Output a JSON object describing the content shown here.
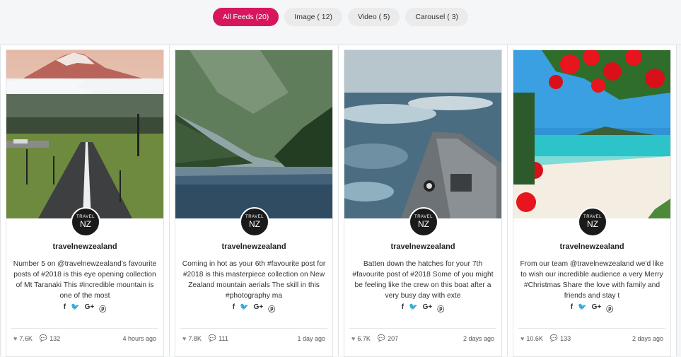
{
  "filters": [
    {
      "label": "All Feeds (20)",
      "active": true
    },
    {
      "label": "Image ( 12)",
      "active": false
    },
    {
      "label": "Video ( 5)",
      "active": false
    },
    {
      "label": "Carousel ( 3)",
      "active": false
    }
  ],
  "accent_color": "#d6175d",
  "avatar": {
    "line1": "TRAVEL",
    "line2": "NZ"
  },
  "share_icons": [
    "facebook-icon",
    "twitter-icon",
    "google-plus-icon",
    "pinterest-icon"
  ],
  "share_glyphs": {
    "facebook": "f",
    "twitter": "🐦",
    "google": "G+",
    "pinterest": "ⓟ"
  },
  "cards": [
    {
      "username": "travelnewzealand",
      "caption": "Number 5 on @travelnewzealand's favourite posts of #2018 is this eye opening collection of Mt Taranaki This #incredible mountain is one of the most",
      "likes": "7.6K",
      "comments": "132",
      "time": "4 hours ago",
      "image": "mountain-road"
    },
    {
      "username": "travelnewzealand",
      "caption": "Coming in hot as your 6th #favourite post for #2018 is this masterpiece collection on New Zealand mountain aerials The skill in this #photography ma",
      "likes": "7.8K",
      "comments": "111",
      "time": "1 day ago",
      "image": "fjord"
    },
    {
      "username": "travelnewzealand",
      "caption": "Batten down the hatches for your 7th #favourite post of #2018 Some of you might be feeling like the crew on this boat after a very busy day with exte",
      "likes": "6.7K",
      "comments": "207",
      "time": "2 days ago",
      "image": "ship-sea"
    },
    {
      "username": "travelnewzealand",
      "caption": "From our team @travelnewzealand we'd like to wish our incredible audience a very Merry #Christmas Share the love with family and friends and stay t",
      "likes": "10.6K",
      "comments": "133",
      "time": "2 days ago",
      "image": "beach-pohutukawa"
    }
  ]
}
